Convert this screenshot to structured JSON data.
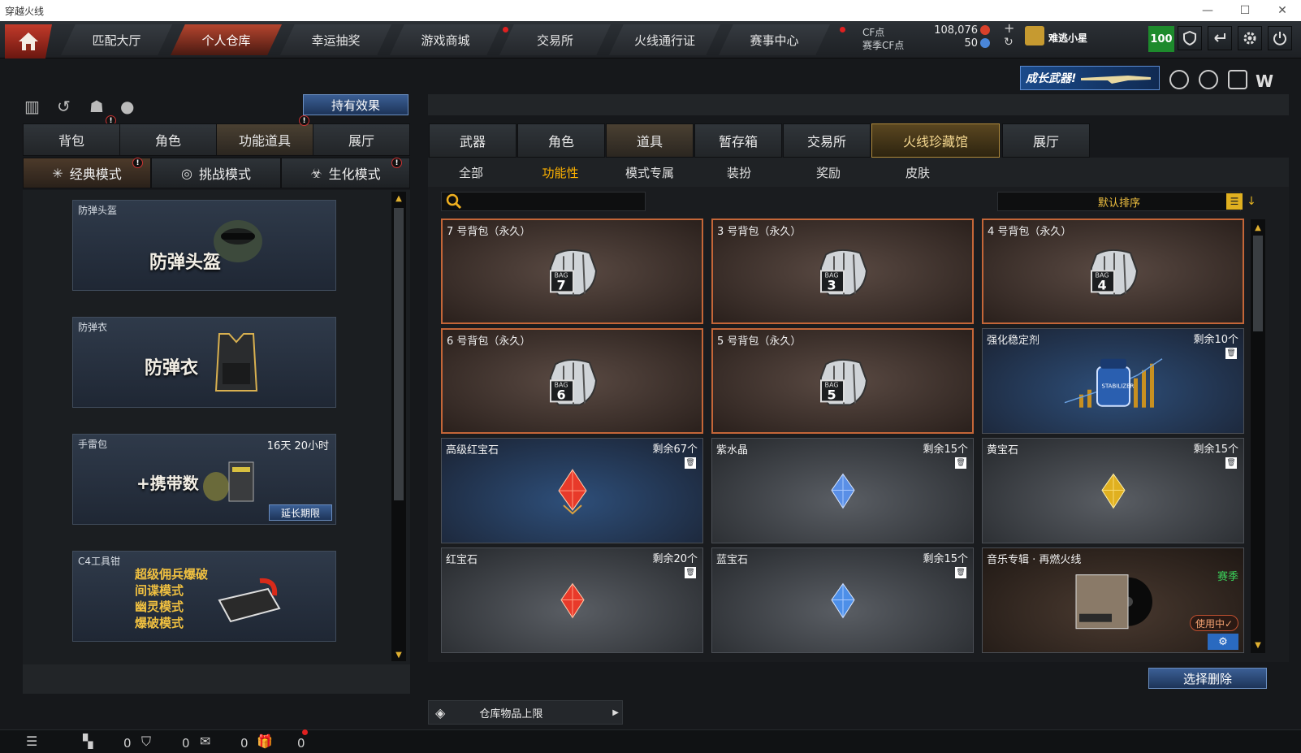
{
  "window": {
    "title": "穿越火线",
    "minimize": "—",
    "maximize": "☐",
    "close": "✕"
  },
  "nav": {
    "tabs": [
      {
        "label": "匹配大厅"
      },
      {
        "label": "个人仓库"
      },
      {
        "label": "幸运抽奖"
      },
      {
        "label": "游戏商城"
      },
      {
        "label": "交易所"
      },
      {
        "label": "火线通行证"
      },
      {
        "label": "赛事中心"
      }
    ]
  },
  "currency": {
    "cf_label": "CF点",
    "cf_value": "108,076",
    "season_label": "赛季CF点",
    "season_value": "50",
    "plus": "+",
    "refresh": "↻"
  },
  "user": {
    "name": "难逃小星",
    "level": "100"
  },
  "banner": {
    "text": "成长武器!"
  },
  "left": {
    "effect_button": "持有效果",
    "tabs": [
      "背包",
      "角色",
      "功能道具",
      "展厅"
    ],
    "modes": [
      "经典模式",
      "挑战模式",
      "生化模式"
    ],
    "items": [
      {
        "name": "防弹头盔",
        "big": "防弹头盔"
      },
      {
        "name": "防弹衣",
        "big": "防弹衣"
      },
      {
        "name": "手雷包",
        "time": "16天 20小时",
        "big": "+携带数",
        "extend": "延长期限"
      },
      {
        "name": "C4工具钳",
        "lines": [
          "超级佣兵爆破",
          "间谍模式",
          "幽灵模式",
          "爆破模式"
        ]
      }
    ]
  },
  "right": {
    "tabs": [
      "武器",
      "角色",
      "道具",
      "暂存箱",
      "交易所",
      "火线珍藏馆",
      "展厅"
    ],
    "filters": [
      "全部",
      "功能性",
      "模式专属",
      "装扮",
      "奖励",
      "皮肤"
    ],
    "search_placeholder": "",
    "sort": "默认排序",
    "items": [
      {
        "name": "7 号背包（永久）",
        "bag": "7"
      },
      {
        "name": "3 号背包（永久）",
        "bag": "3"
      },
      {
        "name": "4 号背包（永久）",
        "bag": "4"
      },
      {
        "name": "6 号背包（永久）",
        "bag": "6"
      },
      {
        "name": "5 号背包（永久）",
        "bag": "5"
      },
      {
        "name": "强化稳定剂",
        "remain": "剩余10个",
        "label": "STABILIZER"
      },
      {
        "name": "高级红宝石",
        "remain": "剩余67个"
      },
      {
        "name": "紫水晶",
        "remain": "剩余15个"
      },
      {
        "name": "黄宝石",
        "remain": "剩余15个"
      },
      {
        "name": "红宝石",
        "remain": "剩余20个"
      },
      {
        "name": "蓝宝石",
        "remain": "剩余15个"
      },
      {
        "name": "音乐专辑 · 再燃火线",
        "season": "赛季",
        "inuse": "使用中✓"
      }
    ],
    "bag_text": "BAG",
    "delete_button": "选择删除",
    "capacity": "仓库物品上限"
  },
  "bottom": {
    "counts": [
      "0",
      "0",
      "0",
      "0"
    ]
  },
  "colors": {
    "accent": "#ffb300",
    "bag_border": "#c46638",
    "red_gem": "#e83a2a",
    "blue_gem": "#4d8fe8",
    "yellow_gem": "#e0b020"
  }
}
